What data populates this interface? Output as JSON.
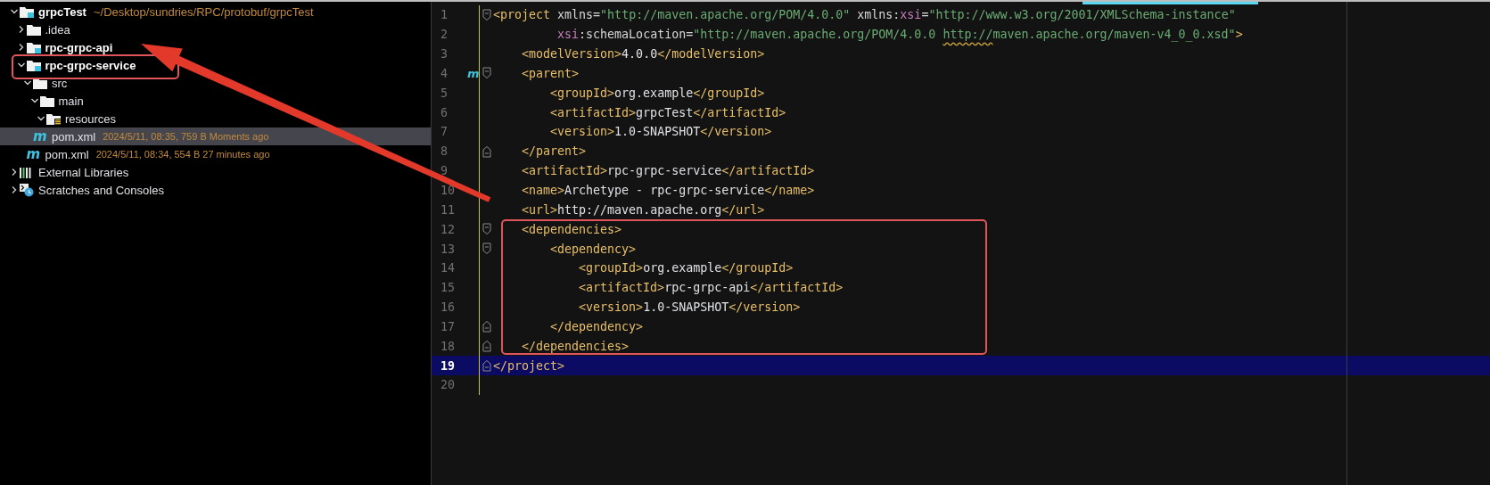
{
  "project_tree": [
    {
      "name": "grpcTest",
      "kind": "module",
      "hint": "~/Desktop/sundries/RPC/protobuf/grpcTest",
      "expanded": true,
      "selected": false,
      "children": [
        {
          "name": ".idea",
          "kind": "folder",
          "expanded": false,
          "selected": false
        },
        {
          "name": "rpc-grpc-api",
          "kind": "module",
          "expanded": false,
          "selected": false
        },
        {
          "name": "rpc-grpc-service",
          "kind": "module",
          "expanded": true,
          "selected": false,
          "children": [
            {
              "name": "src",
              "kind": "folder",
              "expanded": true,
              "selected": false,
              "children": [
                {
                  "name": "main",
                  "kind": "folder",
                  "expanded": true,
                  "selected": false,
                  "children": [
                    {
                      "name": "resources",
                      "kind": "resources",
                      "expanded": true,
                      "selected": false
                    }
                  ]
                }
              ]
            },
            {
              "name": "pom.xml",
              "kind": "maven",
              "glyph": "m",
              "hint": "2024/5/11, 08:35, 759 B Moments ago",
              "selected": true
            }
          ]
        },
        {
          "name": "pom.xml",
          "kind": "maven",
          "glyph": "m",
          "hint": "2024/5/11, 08:34, 554 B 27 minutes ago",
          "selected": false
        }
      ]
    },
    {
      "name": "External Libraries",
      "kind": "libraries",
      "expanded": false,
      "selected": false
    },
    {
      "name": "Scratches and Consoles",
      "kind": "scratches",
      "expanded": false,
      "selected": false
    }
  ],
  "editor": {
    "lines": [
      {
        "number": "1",
        "kind": "fold-start",
        "current": false,
        "tokens": [
          {
            "kind": "tag",
            "text": "<project"
          },
          {
            "kind": "attr",
            "text": " xmlns"
          },
          {
            "kind": "punct",
            "text": "="
          },
          {
            "kind": "value",
            "text": "\"http://maven.apache.org/POM/4.0.0\""
          },
          {
            "kind": "attr",
            "text": " xmlns:"
          },
          {
            "kind": "ns",
            "text": "xsi"
          },
          {
            "kind": "punct",
            "text": "="
          },
          {
            "kind": "value",
            "text": "\"http://www.w3.org/2001/XMLSchema-instance\""
          }
        ]
      },
      {
        "number": "2",
        "kind": "plain",
        "current": false,
        "tokens": [
          {
            "kind": "ns",
            "text": "         xsi"
          },
          {
            "kind": "attr",
            "text": ":schemaLocation"
          },
          {
            "kind": "punct",
            "text": "="
          },
          {
            "kind": "value",
            "text": "\"http://maven.apache.org/POM/4.0.0 "
          },
          {
            "kind": "value-warn",
            "text": "http://"
          },
          {
            "kind": "value",
            "text": "maven.apache.org/maven-v4_0_0.xsd\""
          },
          {
            "kind": "tag",
            "text": ">"
          }
        ]
      },
      {
        "number": "3",
        "kind": "plain",
        "current": false,
        "tokens": [
          {
            "kind": "tag",
            "text": "    <modelVersion>"
          },
          {
            "kind": "text",
            "text": "4.0.0"
          },
          {
            "kind": "tag",
            "text": "</modelVersion>"
          }
        ]
      },
      {
        "number": "4",
        "kind": "fold-start",
        "gutter_glyph": "m",
        "current": false,
        "tokens": [
          {
            "kind": "tag",
            "text": "    <parent>"
          }
        ]
      },
      {
        "number": "5",
        "kind": "plain",
        "current": false,
        "tokens": [
          {
            "kind": "tag",
            "text": "        <groupId>"
          },
          {
            "kind": "text",
            "text": "org.example"
          },
          {
            "kind": "tag",
            "text": "</groupId>"
          }
        ]
      },
      {
        "number": "6",
        "kind": "plain",
        "current": false,
        "tokens": [
          {
            "kind": "tag",
            "text": "        <artifactId>"
          },
          {
            "kind": "text",
            "text": "grpcTest"
          },
          {
            "kind": "tag",
            "text": "</artifactId>"
          }
        ]
      },
      {
        "number": "7",
        "kind": "plain",
        "current": false,
        "tokens": [
          {
            "kind": "tag",
            "text": "        <version>"
          },
          {
            "kind": "text",
            "text": "1.0-SNAPSHOT"
          },
          {
            "kind": "tag",
            "text": "</version>"
          }
        ]
      },
      {
        "number": "8",
        "kind": "fold-end",
        "current": false,
        "tokens": [
          {
            "kind": "tag",
            "text": "    </parent>"
          }
        ]
      },
      {
        "number": "9",
        "kind": "plain",
        "current": false,
        "tokens": [
          {
            "kind": "tag",
            "text": "    <artifactId>"
          },
          {
            "kind": "text",
            "text": "rpc-grpc-service"
          },
          {
            "kind": "tag",
            "text": "</artifactId>"
          }
        ]
      },
      {
        "number": "10",
        "kind": "plain",
        "current": false,
        "tokens": [
          {
            "kind": "tag",
            "text": "    <name>"
          },
          {
            "kind": "text",
            "text": "Archetype - rpc-grpc-service"
          },
          {
            "kind": "tag",
            "text": "</name>"
          }
        ]
      },
      {
        "number": "11",
        "kind": "plain",
        "current": false,
        "tokens": [
          {
            "kind": "tag",
            "text": "    <url>"
          },
          {
            "kind": "text",
            "text": "http://maven.apache.org"
          },
          {
            "kind": "tag",
            "text": "</url>"
          }
        ]
      },
      {
        "number": "12",
        "kind": "fold-start",
        "current": false,
        "tokens": [
          {
            "kind": "tag",
            "text": "    <dependencies>"
          }
        ]
      },
      {
        "number": "13",
        "kind": "fold-start",
        "current": false,
        "tokens": [
          {
            "kind": "tag",
            "text": "        <dependency>"
          }
        ]
      },
      {
        "number": "14",
        "kind": "plain",
        "current": false,
        "tokens": [
          {
            "kind": "tag",
            "text": "            <groupId>"
          },
          {
            "kind": "text",
            "text": "org.example"
          },
          {
            "kind": "tag",
            "text": "</groupId>"
          }
        ]
      },
      {
        "number": "15",
        "kind": "plain",
        "current": false,
        "tokens": [
          {
            "kind": "tag",
            "text": "            <artifactId>"
          },
          {
            "kind": "text",
            "text": "rpc-grpc-api"
          },
          {
            "kind": "tag",
            "text": "</artifactId>"
          }
        ]
      },
      {
        "number": "16",
        "kind": "plain",
        "current": false,
        "tokens": [
          {
            "kind": "tag",
            "text": "            <version>"
          },
          {
            "kind": "text",
            "text": "1.0-SNAPSHOT"
          },
          {
            "kind": "tag",
            "text": "</version>"
          }
        ]
      },
      {
        "number": "17",
        "kind": "fold-end",
        "current": false,
        "tokens": [
          {
            "kind": "tag",
            "text": "        </dependency>"
          }
        ]
      },
      {
        "number": "18",
        "kind": "fold-end",
        "current": false,
        "tokens": [
          {
            "kind": "tag",
            "text": "    </dependencies>"
          }
        ]
      },
      {
        "number": "19",
        "kind": "fold-end",
        "current": true,
        "tokens": [
          {
            "kind": "tag",
            "text": "</project>"
          }
        ]
      },
      {
        "number": "20",
        "kind": "plain",
        "current": false
      }
    ]
  }
}
